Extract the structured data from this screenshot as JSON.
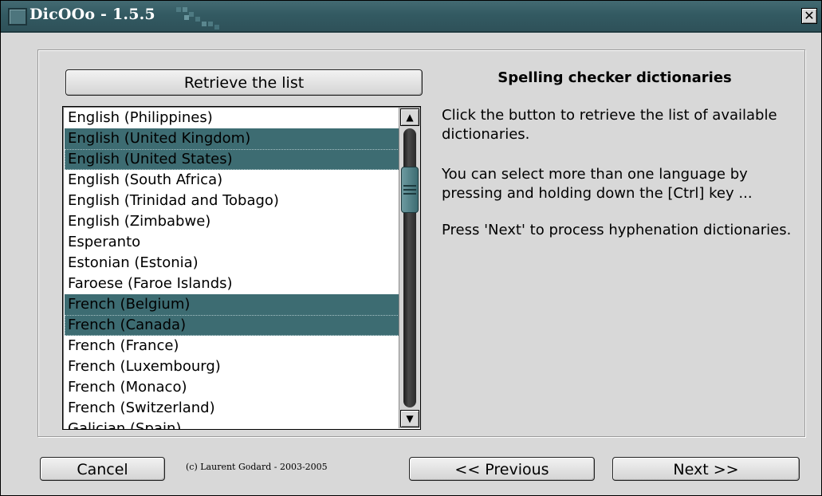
{
  "window": {
    "title": "DicOOo - 1.5.5",
    "close_glyph": "✕"
  },
  "toolbar": {
    "retrieve_label": "Retrieve the list"
  },
  "languages": {
    "items": [
      {
        "label": "English (Philippines)",
        "selected": false
      },
      {
        "label": "English (United Kingdom)",
        "selected": true
      },
      {
        "label": "English (United States)",
        "selected": true
      },
      {
        "label": "English (South Africa)",
        "selected": false
      },
      {
        "label": "English (Trinidad and Tobago)",
        "selected": false
      },
      {
        "label": "English (Zimbabwe)",
        "selected": false
      },
      {
        "label": "Esperanto",
        "selected": false
      },
      {
        "label": "Estonian (Estonia)",
        "selected": false
      },
      {
        "label": "Faroese (Faroe Islands)",
        "selected": false
      },
      {
        "label": "French (Belgium)",
        "selected": true
      },
      {
        "label": "French (Canada)",
        "selected": true
      },
      {
        "label": "French (France)",
        "selected": false
      },
      {
        "label": "French (Luxembourg)",
        "selected": false
      },
      {
        "label": "French (Monaco)",
        "selected": false
      },
      {
        "label": "French (Switzerland)",
        "selected": false
      },
      {
        "label": "Galician (Spain)",
        "selected": false
      }
    ]
  },
  "info": {
    "heading": "Spelling checker dictionaries",
    "paragraph1": "Click the button to retrieve the list of available dictionaries.",
    "paragraph2": "You can select more than one language by pressing and holding down  the [Ctrl] key ...",
    "paragraph3": "Press 'Next' to process hyphenation dictionaries."
  },
  "footer": {
    "cancel_label": "Cancel",
    "copyright": "(c) Laurent Godard - 2003-2005",
    "previous_label": "<< Previous",
    "next_label": "Next >>"
  },
  "colors": {
    "titlebar": "#335a62",
    "selection": "#3d6c72",
    "window_bg": "#d8d8d8"
  }
}
